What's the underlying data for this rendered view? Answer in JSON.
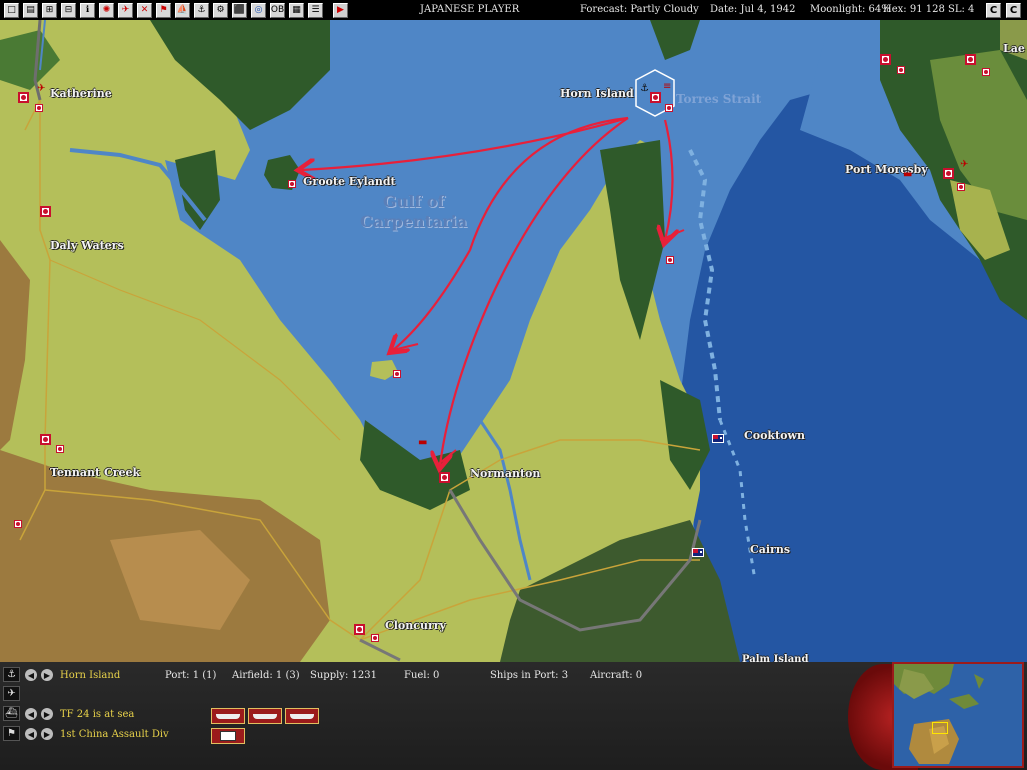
{
  "toolbar": {
    "player": "JAPANESE PLAYER",
    "forecast": "Forecast: Partly Cloudy",
    "date": "Date: Jul 4, 1942",
    "moonlight": "Moonlight: 64%",
    "hex": "Hex: 91  128  SL: 4",
    "buttons": [
      "□",
      "▤",
      "⊞",
      "⊟",
      "ℹ",
      "✺",
      "✈",
      "✕",
      "⚑",
      "⛵",
      "⚓",
      "⚙",
      "⬛",
      "◎",
      "OB",
      "▦",
      "☰"
    ],
    "play": "▶",
    "corner_c1": "C",
    "corner_c2": "C"
  },
  "map": {
    "places": {
      "katherine": "Katherine",
      "daly_waters": "Daly Waters",
      "tennant_creek": "Tennant Creek",
      "groote_eylandt": "Groote Eylandt",
      "horn_island": "Horn Island",
      "normanton": "Normanton",
      "cloncurry": "Cloncurry",
      "cooktown": "Cooktown",
      "cairns": "Cairns",
      "port_moresby": "Port Moresby",
      "lae": "Lae",
      "palm_island": "Palm Island"
    },
    "sea": {
      "gulf_line1": "Gulf of",
      "gulf_line2": "Carpentaria",
      "torres": "Torres Strait"
    }
  },
  "panel": {
    "base_name": "Horn Island",
    "port": "Port: 1 (1)",
    "airfield": "Airfield: 1 (3)",
    "supply": "Supply: 1231",
    "fuel": "Fuel: 0",
    "ships_in_port": "Ships in Port: 3",
    "aircraft": "Aircraft: 0",
    "task_force": "TF 24 is at sea",
    "land_unit": "1st China Assault Div",
    "side_icons": [
      "⚓",
      "✈",
      "⛴",
      "⚑"
    ],
    "prev": "◀",
    "next": "▶"
  },
  "colors": {
    "sea_shallow": "#4f86c6",
    "sea_deep": "#2456a3",
    "land": "#b4bf5a",
    "desert": "#9c7a3f",
    "jungle": "#2f5a2a",
    "route": "#e8203a"
  }
}
